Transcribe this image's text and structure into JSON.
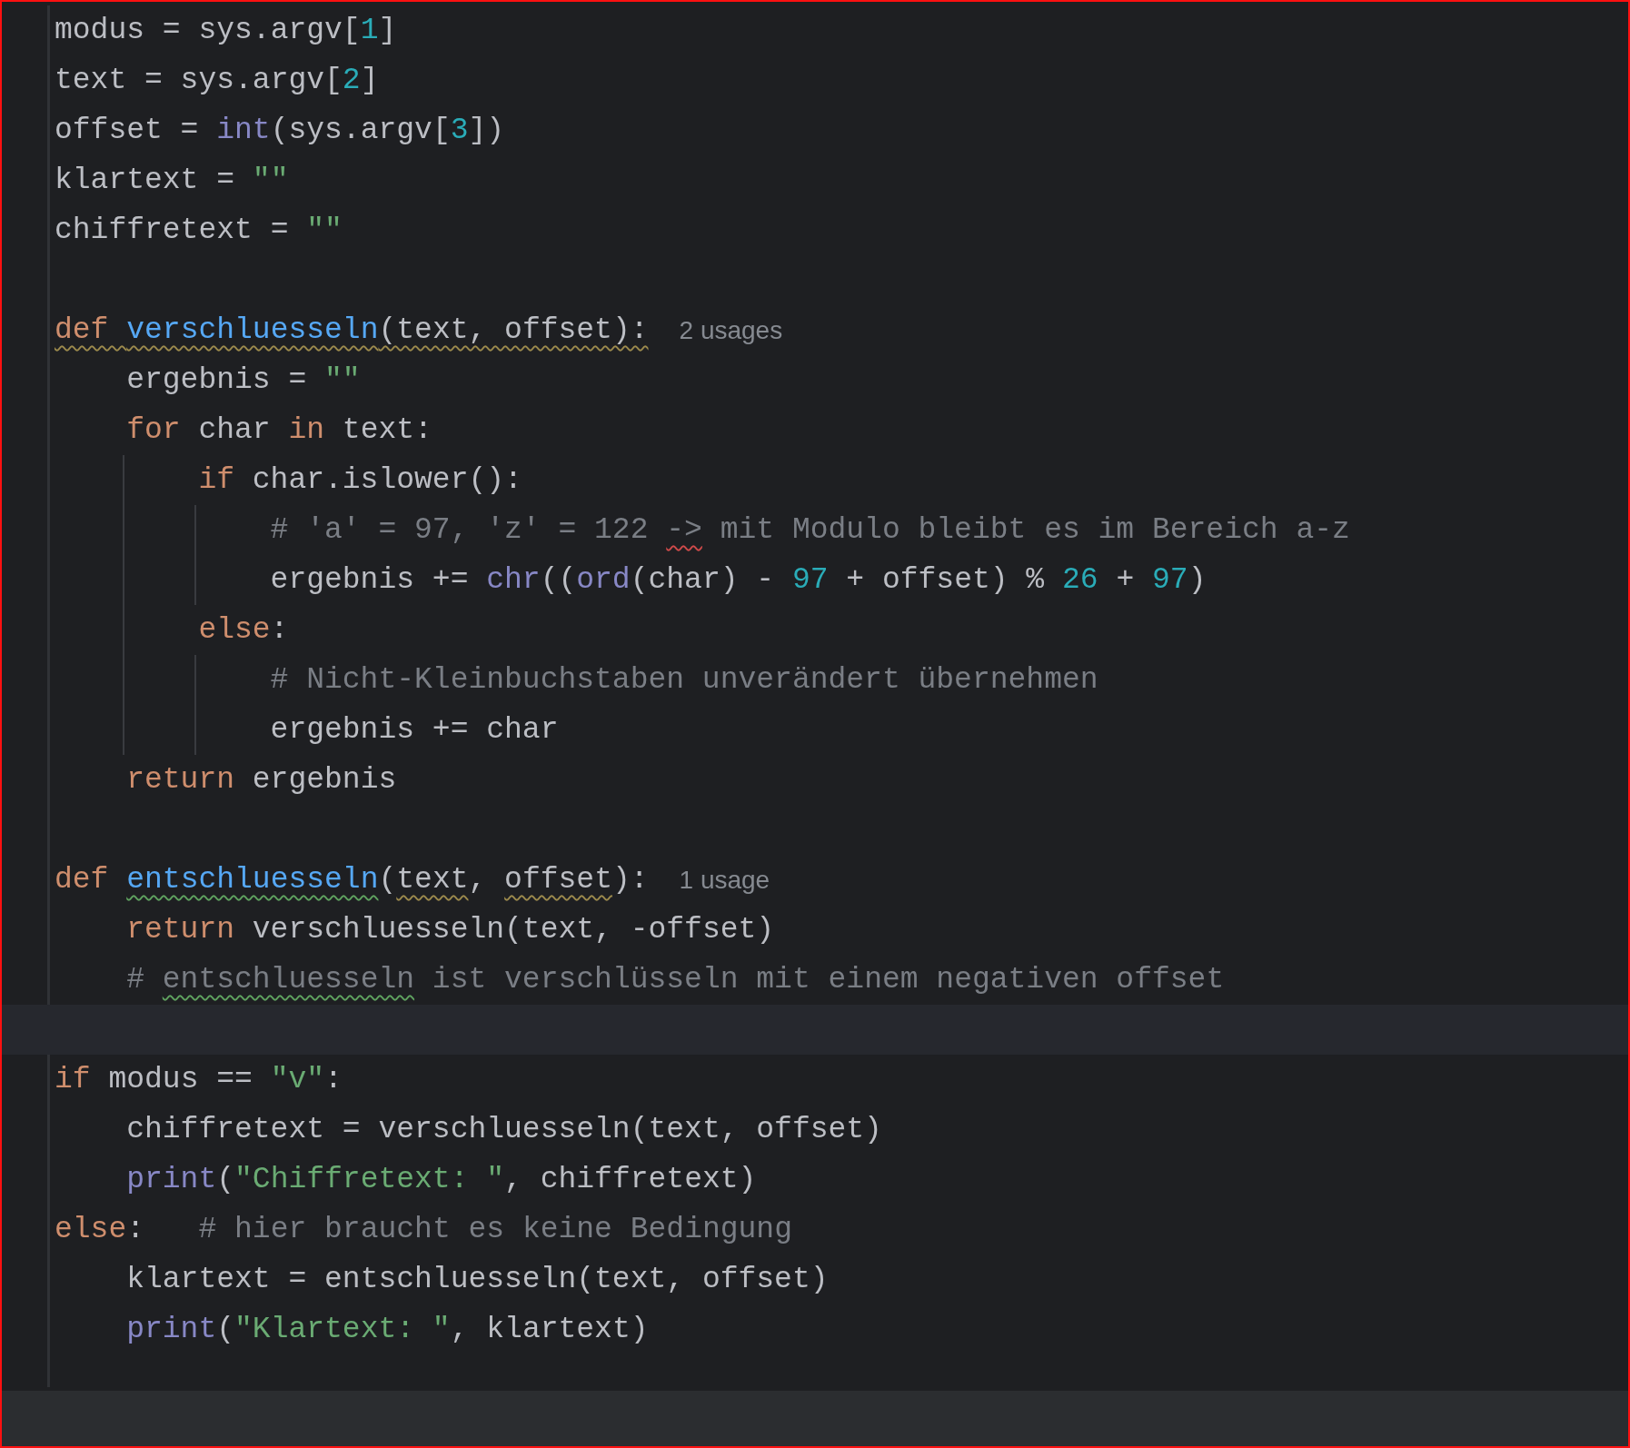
{
  "editor": {
    "lines": [
      {
        "tokens": [
          {
            "text": "modus = sys.argv[",
            "kind": "plain"
          },
          {
            "text": "1",
            "kind": "number"
          },
          {
            "text": "]",
            "kind": "plain"
          }
        ]
      },
      {
        "tokens": [
          {
            "text": "text = sys.argv[",
            "kind": "plain"
          },
          {
            "text": "2",
            "kind": "number"
          },
          {
            "text": "]",
            "kind": "plain"
          }
        ]
      },
      {
        "tokens": [
          {
            "text": "offset = ",
            "kind": "plain"
          },
          {
            "text": "int",
            "kind": "builtin"
          },
          {
            "text": "(sys.argv[",
            "kind": "plain"
          },
          {
            "text": "3",
            "kind": "number"
          },
          {
            "text": "])",
            "kind": "plain"
          }
        ]
      },
      {
        "tokens": [
          {
            "text": "klartext = ",
            "kind": "plain"
          },
          {
            "text": "\"\"",
            "kind": "string"
          }
        ]
      },
      {
        "tokens": [
          {
            "text": "chiffretext = ",
            "kind": "plain"
          },
          {
            "text": "\"\"",
            "kind": "string"
          }
        ]
      },
      {
        "blank_before": true,
        "tokens": [
          {
            "text": "def ",
            "kind": "keyword",
            "warning": true
          },
          {
            "text": "verschluesseln",
            "kind": "function",
            "warning": true
          },
          {
            "text": "(text, offset):",
            "kind": "plain",
            "warning": true
          }
        ],
        "hint": "2 usages"
      },
      {
        "tokens": [
          {
            "text": "    ergebnis = ",
            "kind": "plain"
          },
          {
            "text": "\"\"",
            "kind": "string"
          }
        ]
      },
      {
        "tokens": [
          {
            "text": "    for",
            "kind": "keyword"
          },
          {
            "text": " char ",
            "kind": "plain"
          },
          {
            "text": "in",
            "kind": "keyword"
          },
          {
            "text": " text:",
            "kind": "plain"
          }
        ]
      },
      {
        "tokens": [
          {
            "text": "        if",
            "kind": "keyword"
          },
          {
            "text": " char.islower():",
            "kind": "plain"
          }
        ]
      },
      {
        "tokens": [
          {
            "text": "            # 'a' = 97, 'z' = 122 ",
            "kind": "comment"
          },
          {
            "text": "->",
            "kind": "comment",
            "error": true
          },
          {
            "text": " mit Modulo bleibt es im Bereich a-z",
            "kind": "comment"
          }
        ]
      },
      {
        "tokens": [
          {
            "text": "            ergebnis += ",
            "kind": "plain"
          },
          {
            "text": "chr",
            "kind": "builtin"
          },
          {
            "text": "((",
            "kind": "plain"
          },
          {
            "text": "ord",
            "kind": "builtin"
          },
          {
            "text": "(char) - ",
            "kind": "plain"
          },
          {
            "text": "97",
            "kind": "number"
          },
          {
            "text": " + offset) % ",
            "kind": "plain"
          },
          {
            "text": "26",
            "kind": "number"
          },
          {
            "text": " + ",
            "kind": "plain"
          },
          {
            "text": "97",
            "kind": "number"
          },
          {
            "text": ")",
            "kind": "plain"
          }
        ]
      },
      {
        "tokens": [
          {
            "text": "        else",
            "kind": "keyword"
          },
          {
            "text": ":",
            "kind": "plain"
          }
        ]
      },
      {
        "tokens": [
          {
            "text": "            # Nicht-Kleinbuchstaben unverändert übernehmen",
            "kind": "comment"
          }
        ]
      },
      {
        "tokens": [
          {
            "text": "            ergebnis += char",
            "kind": "plain"
          }
        ]
      },
      {
        "tokens": [
          {
            "text": "    return",
            "kind": "keyword"
          },
          {
            "text": " ergebnis",
            "kind": "plain"
          }
        ]
      },
      {
        "blank_before": true,
        "tokens": [
          {
            "text": "def ",
            "kind": "keyword"
          },
          {
            "text": "entschluesseln",
            "kind": "function",
            "typo": true
          },
          {
            "text": "(",
            "kind": "plain"
          },
          {
            "text": "text",
            "kind": "plain",
            "warning": true
          },
          {
            "text": ", ",
            "kind": "plain"
          },
          {
            "text": "offset",
            "kind": "plain",
            "warning": true
          },
          {
            "text": "):",
            "kind": "plain"
          }
        ],
        "hint": "1 usage"
      },
      {
        "tokens": [
          {
            "text": "    return",
            "kind": "keyword"
          },
          {
            "text": " verschluesseln(text, -offset)",
            "kind": "plain"
          }
        ]
      },
      {
        "tokens": [
          {
            "text": "    # ",
            "kind": "comment"
          },
          {
            "text": "entschluesseln",
            "kind": "comment",
            "typo": true
          },
          {
            "text": " ist verschlüsseln mit einem negativen offset",
            "kind": "comment"
          }
        ]
      },
      {
        "current": true
      },
      {
        "tokens": [
          {
            "text": "if",
            "kind": "keyword"
          },
          {
            "text": " modus == ",
            "kind": "plain"
          },
          {
            "text": "\"v\"",
            "kind": "string"
          },
          {
            "text": ":",
            "kind": "plain"
          }
        ]
      },
      {
        "tokens": [
          {
            "text": "    chiffretext = verschluesseln(text, offset)",
            "kind": "plain"
          }
        ]
      },
      {
        "tokens": [
          {
            "text": "    print",
            "kind": "builtin"
          },
          {
            "text": "(",
            "kind": "plain"
          },
          {
            "text": "\"Chiffretext: \"",
            "kind": "string"
          },
          {
            "text": ", chiffretext)",
            "kind": "plain"
          }
        ]
      },
      {
        "tokens": [
          {
            "text": "else",
            "kind": "keyword"
          },
          {
            "text": ":",
            "kind": "plain"
          },
          {
            "text": "   # hier braucht es keine Bedingung",
            "kind": "comment"
          }
        ]
      },
      {
        "tokens": [
          {
            "text": "    klartext = entschluesseln(text, offset)",
            "kind": "plain"
          }
        ]
      },
      {
        "tokens": [
          {
            "text": "    print",
            "kind": "builtin"
          },
          {
            "text": "(",
            "kind": "plain"
          },
          {
            "text": "\"Klartext: \"",
            "kind": "string"
          },
          {
            "text": ", klartext)",
            "kind": "plain"
          }
        ]
      }
    ]
  }
}
